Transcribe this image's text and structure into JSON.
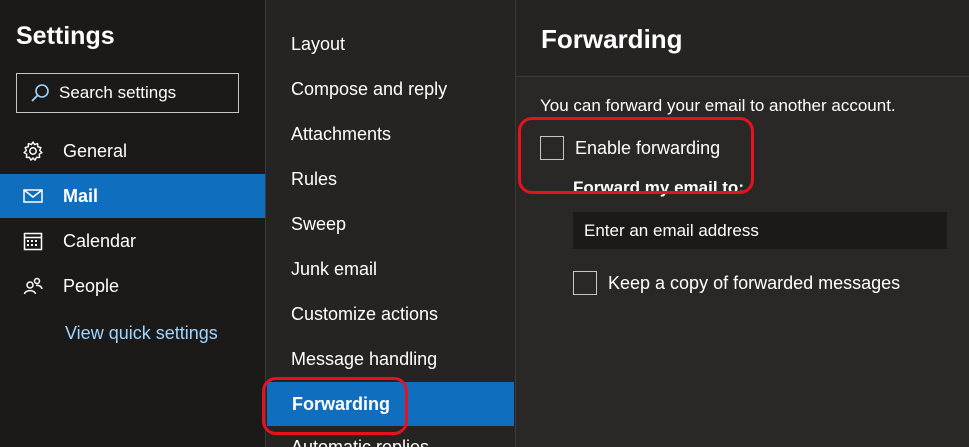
{
  "left": {
    "title": "Settings",
    "search_placeholder": "Search settings",
    "items": [
      {
        "label": "General",
        "icon": "gear-icon"
      },
      {
        "label": "Mail",
        "icon": "mail-icon",
        "selected": true
      },
      {
        "label": "Calendar",
        "icon": "calendar-icon"
      },
      {
        "label": "People",
        "icon": "people-icon"
      }
    ],
    "quick_link": "View quick settings"
  },
  "middle": {
    "items": [
      {
        "label": "Layout"
      },
      {
        "label": "Compose and reply"
      },
      {
        "label": "Attachments"
      },
      {
        "label": "Rules"
      },
      {
        "label": "Sweep"
      },
      {
        "label": "Junk email"
      },
      {
        "label": "Customize actions"
      },
      {
        "label": "Message handling"
      },
      {
        "label": "Forwarding",
        "selected": true
      },
      {
        "label": "Automatic replies"
      }
    ]
  },
  "right": {
    "title": "Forwarding",
    "description": "You can forward your email to another account.",
    "enable_label": "Enable forwarding",
    "enable_checked": false,
    "forward_to_label": "Forward my email to:",
    "email_placeholder": "Enter an email address",
    "keep_copy_label": "Keep a copy of forwarded messages",
    "keep_copy_checked": false
  },
  "colors": {
    "accent": "#106ebe",
    "link": "#9fd5ff",
    "annotation": "#e8111e"
  }
}
